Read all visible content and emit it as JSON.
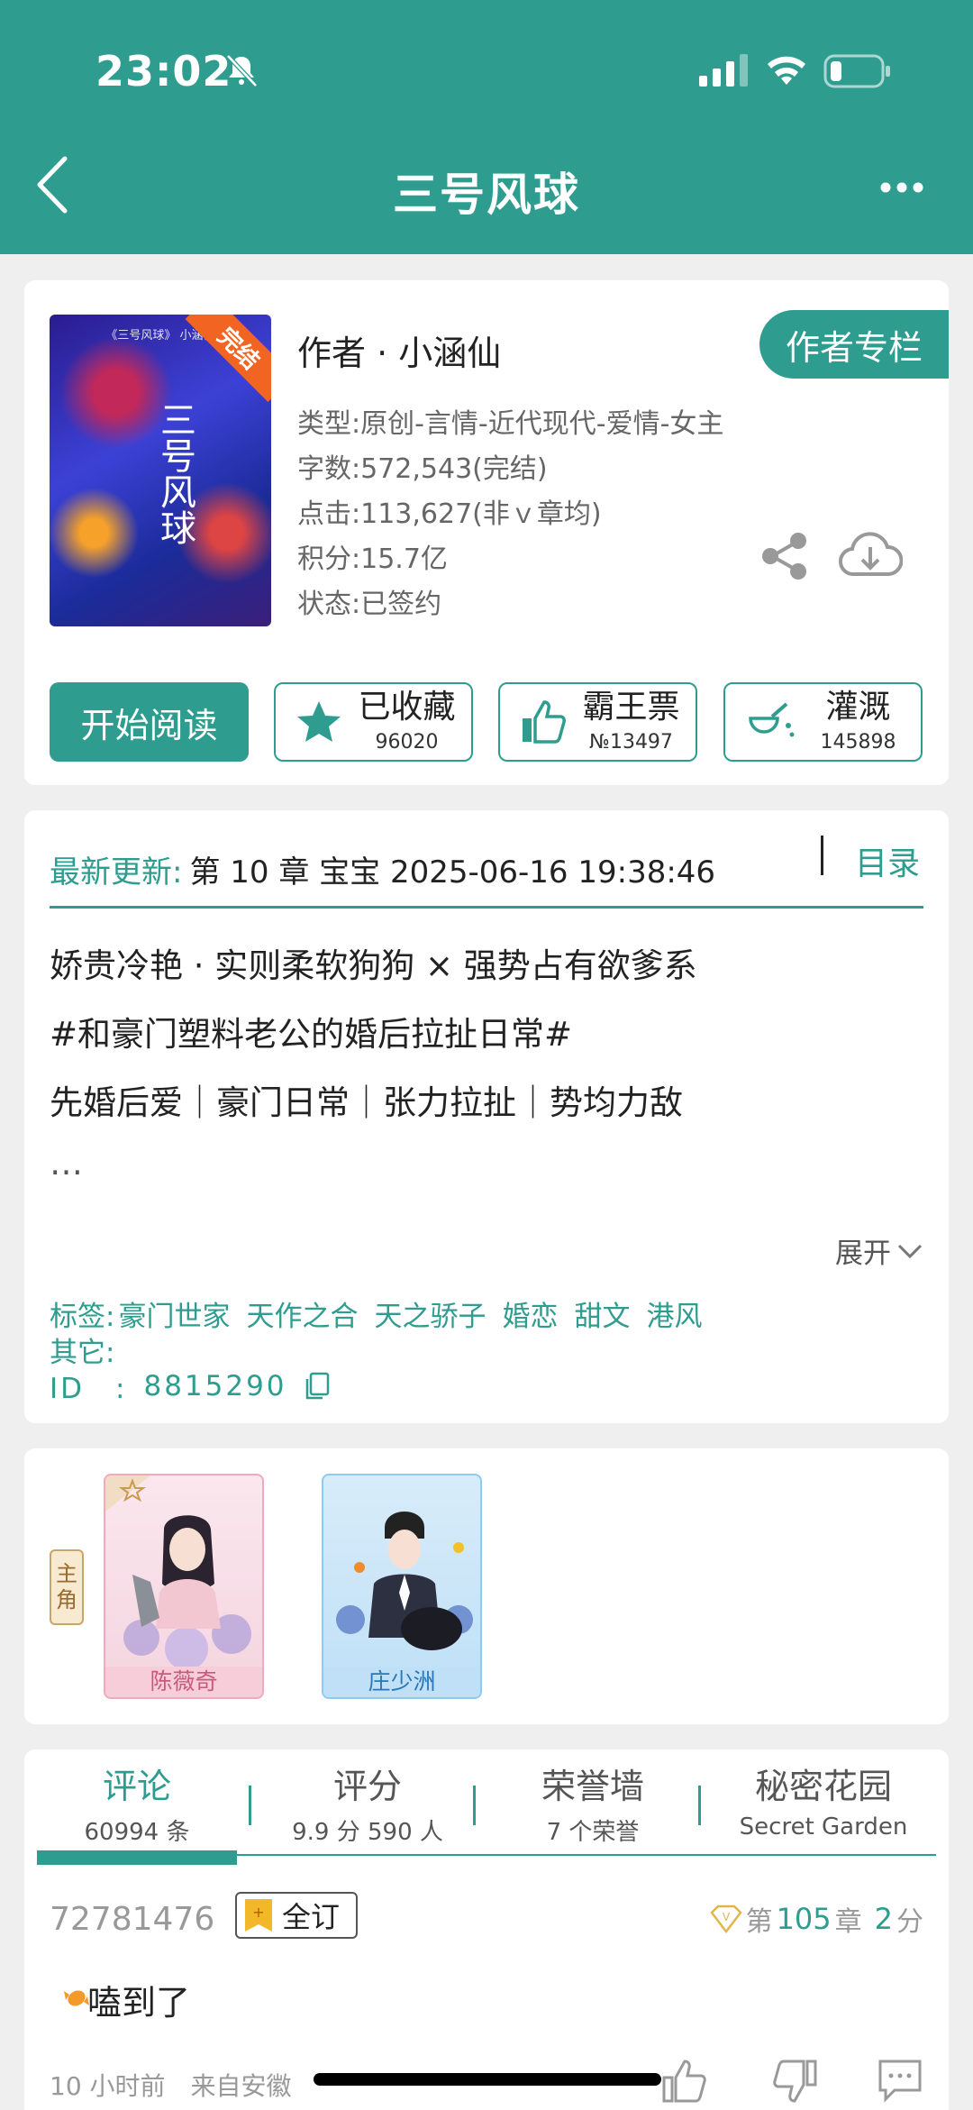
{
  "status_bar": {
    "time": "23:02"
  },
  "header": {
    "title": "三号风球"
  },
  "book": {
    "cover": {
      "badge": "完结",
      "title": "三号风球",
      "top_text": "《三号风球》 小涵仙"
    },
    "author": "作者 · 小涵仙",
    "author_column_label": "作者专栏",
    "meta": [
      "类型:原创-言情-近代现代-爱情-女主",
      "字数:572,543(完结)",
      "点击:113,627(非ｖ章均)",
      "积分:15.7亿",
      "状态:已签约"
    ],
    "actions": {
      "read": "开始阅读",
      "collect": {
        "label": "已收藏",
        "count": "96020"
      },
      "vote": {
        "label": "霸王票",
        "count": "№13497"
      },
      "water": {
        "label": "灌溉",
        "count": "145898"
      }
    }
  },
  "intro": {
    "latest_label": "最新更新:",
    "latest_text": "第 10 章 宝宝 2025-06-16 19:38:46",
    "toc": "目录",
    "lines": [
      "娇贵冷艳 · 实则柔软狗狗 × 强势占有欲爹系",
      "#和豪门塑料老公的婚后拉扯日常#",
      "先婚后爱｜豪门日常｜张力拉扯｜势均力敌",
      "…"
    ],
    "expand": "展开",
    "tags_label": "标签:",
    "tags": [
      "豪门世家",
      "天作之合",
      "天之骄子",
      "婚恋",
      "甜文",
      "港风"
    ],
    "other_label": "其它:",
    "id_label": "ID　:",
    "id_value": "8815290"
  },
  "roles": {
    "tag": [
      "主",
      "角"
    ],
    "items": [
      {
        "name": "陈薇奇"
      },
      {
        "name": "庄少洲"
      }
    ]
  },
  "tabs": [
    {
      "label": "评论",
      "sub": "60994 条",
      "active": true
    },
    {
      "label": "评分",
      "sub": "9.9 分 590 人"
    },
    {
      "label": "荣誉墙",
      "sub": "7 个荣誉"
    },
    {
      "label": "秘密花园",
      "sub": "Secret Garden"
    }
  ],
  "comment": {
    "user": "72781476",
    "badge": "全订",
    "chap_prefix": "第",
    "chap_num": "105",
    "chap_unit": "章",
    "score_num": "2",
    "score_unit": "分",
    "text": "嗑到了",
    "meta": "10 小时前　来自安徽"
  },
  "colors": {
    "accent": "#2e9d8f"
  }
}
